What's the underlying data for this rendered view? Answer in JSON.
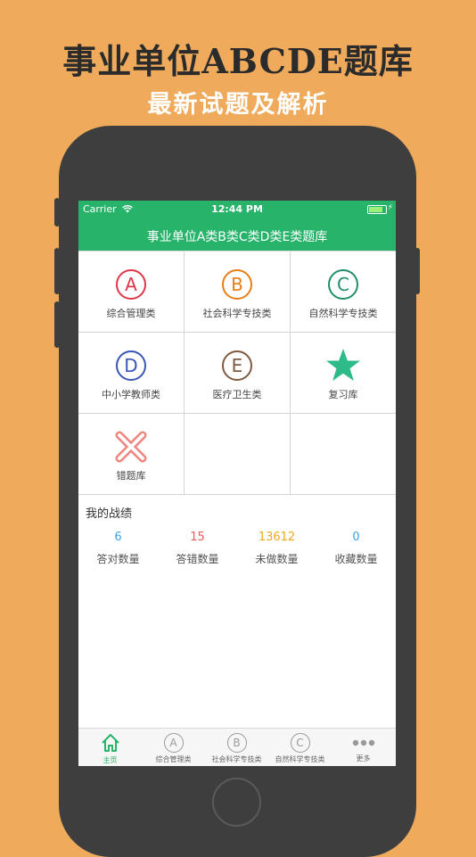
{
  "promo": {
    "title": "事业单位ABCDE题库",
    "subtitle": "最新试题及解析"
  },
  "status_bar": {
    "carrier": "Carrier",
    "time": "12:44 PM"
  },
  "nav": {
    "title": "事业单位A类B类C类D类E类题库"
  },
  "grid": {
    "items": [
      {
        "label": "综合管理类",
        "letter": "A",
        "color": "#E0364B",
        "icon": "circled-a-icon"
      },
      {
        "label": "社会科学专技类",
        "letter": "B",
        "color": "#E97D18",
        "icon": "circled-b-icon"
      },
      {
        "label": "自然科学专技类",
        "letter": "C",
        "color": "#1E8F6A",
        "icon": "circled-c-icon"
      },
      {
        "label": "中小学教师类",
        "letter": "D",
        "color": "#3A55B6",
        "icon": "circled-d-icon"
      },
      {
        "label": "医疗卫生类",
        "letter": "E",
        "color": "#7E5A40",
        "icon": "circled-e-icon"
      },
      {
        "label": "复习库",
        "color": "#2DBB8A",
        "icon": "star-icon"
      },
      {
        "label": "错题库",
        "color": "#F0857F",
        "icon": "cross-icon"
      }
    ]
  },
  "stats": {
    "title": "我的战绩",
    "items": [
      {
        "value": "6",
        "label": "答对数量",
        "color": "#3BA2E8"
      },
      {
        "value": "15",
        "label": "答错数量",
        "color": "#F0575A"
      },
      {
        "value": "13612",
        "label": "未做数量",
        "color": "#F0A81E"
      },
      {
        "value": "0",
        "label": "收藏数量",
        "color": "#3BA2E8"
      }
    ]
  },
  "tabbar": {
    "items": [
      {
        "label": "主页",
        "icon": "home-icon",
        "active": true
      },
      {
        "label": "综合管理类",
        "icon": "circled-a-icon",
        "letter": "A"
      },
      {
        "label": "社会科学专技类",
        "icon": "circled-b-icon",
        "letter": "B"
      },
      {
        "label": "自然科学专技类",
        "icon": "circled-c-icon",
        "letter": "C"
      },
      {
        "label": "更多",
        "icon": "more-icon"
      }
    ],
    "active_color": "#28B36B"
  }
}
